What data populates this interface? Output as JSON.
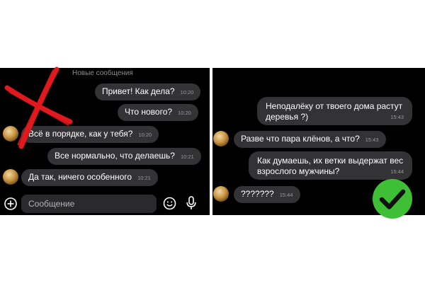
{
  "left_chat": {
    "new_messages_label": "Новые сообщения",
    "messages": [
      {
        "text": "Привет! Как дела?",
        "time": "10:20",
        "from": "me"
      },
      {
        "text": "Что нового?",
        "time": "10:20",
        "from": "me"
      },
      {
        "text": "Всё в порядке, как у тебя?",
        "time": "10:20",
        "from": "other"
      },
      {
        "text": "Все нормально, что делаешь?",
        "time": "10:21",
        "from": "me"
      },
      {
        "text": "Да так, ничего особенного",
        "time": "10:21",
        "from": "other"
      }
    ],
    "composer": {
      "placeholder": "Сообщение"
    },
    "marker": {
      "icon": "red-cross-icon",
      "color": "#e0191d"
    }
  },
  "right_chat": {
    "messages": [
      {
        "line1": "Неподалёку от твоего дома растут",
        "line2": "деревья ?)",
        "time": "15:43",
        "from": "me"
      },
      {
        "text": "Разве что пара клёнов, а что?",
        "time": "15:43",
        "from": "other"
      },
      {
        "line1": "Как думаешь, их ветки выдержат вес",
        "line2": "взрослого мужчины?",
        "time": "15:44",
        "from": "me"
      },
      {
        "text": "???????",
        "time": "15:44",
        "from": "other"
      }
    ],
    "marker": {
      "icon": "green-check-icon",
      "color": "#3fbf35"
    }
  },
  "colors": {
    "background": "#000000",
    "bubble": "#333335",
    "text": "#ffffff",
    "timestamp": "#9a9a9e"
  }
}
